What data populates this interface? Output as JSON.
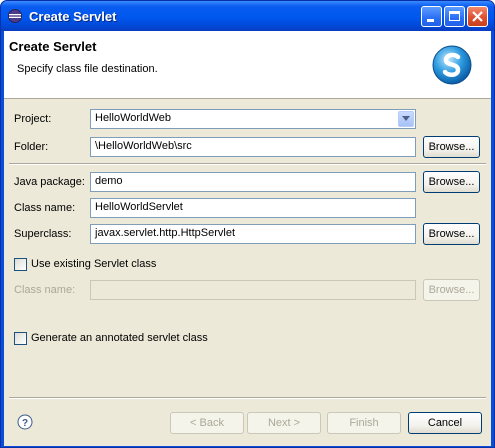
{
  "window": {
    "title": "Create Servlet"
  },
  "banner": {
    "title": "Create Servlet",
    "subtitle": "Specify class file destination."
  },
  "form": {
    "project": {
      "label": "Project:",
      "value": "HelloWorldWeb"
    },
    "folder": {
      "label": "Folder:",
      "value": "\\HelloWorldWeb\\src",
      "browse": "Browse..."
    },
    "java_package": {
      "label": "Java package:",
      "value": "demo",
      "browse": "Browse..."
    },
    "class_name": {
      "label": "Class name:",
      "value": "HelloWorldServlet"
    },
    "superclass": {
      "label": "Superclass:",
      "value": "javax.servlet.http.HttpServlet",
      "browse": "Browse..."
    },
    "use_existing": {
      "label": "Use existing Servlet class",
      "checked": false
    },
    "existing_class_name": {
      "label": "Class name:",
      "value": "",
      "browse": "Browse...",
      "enabled": false
    },
    "annotated": {
      "label": "Generate an annotated servlet class",
      "checked": false
    }
  },
  "footer": {
    "back": "< Back",
    "next": "Next >",
    "finish": "Finish",
    "cancel": "Cancel"
  },
  "colors": {
    "titlebar": "#0058ee",
    "dialog_bg": "#ece9d8",
    "field_border": "#7f9db9"
  },
  "icons": [
    "eclipse-app-icon",
    "minimize-icon",
    "maximize-icon",
    "close-icon",
    "servlet-logo-icon",
    "dropdown-arrow-icon",
    "help-icon"
  ]
}
